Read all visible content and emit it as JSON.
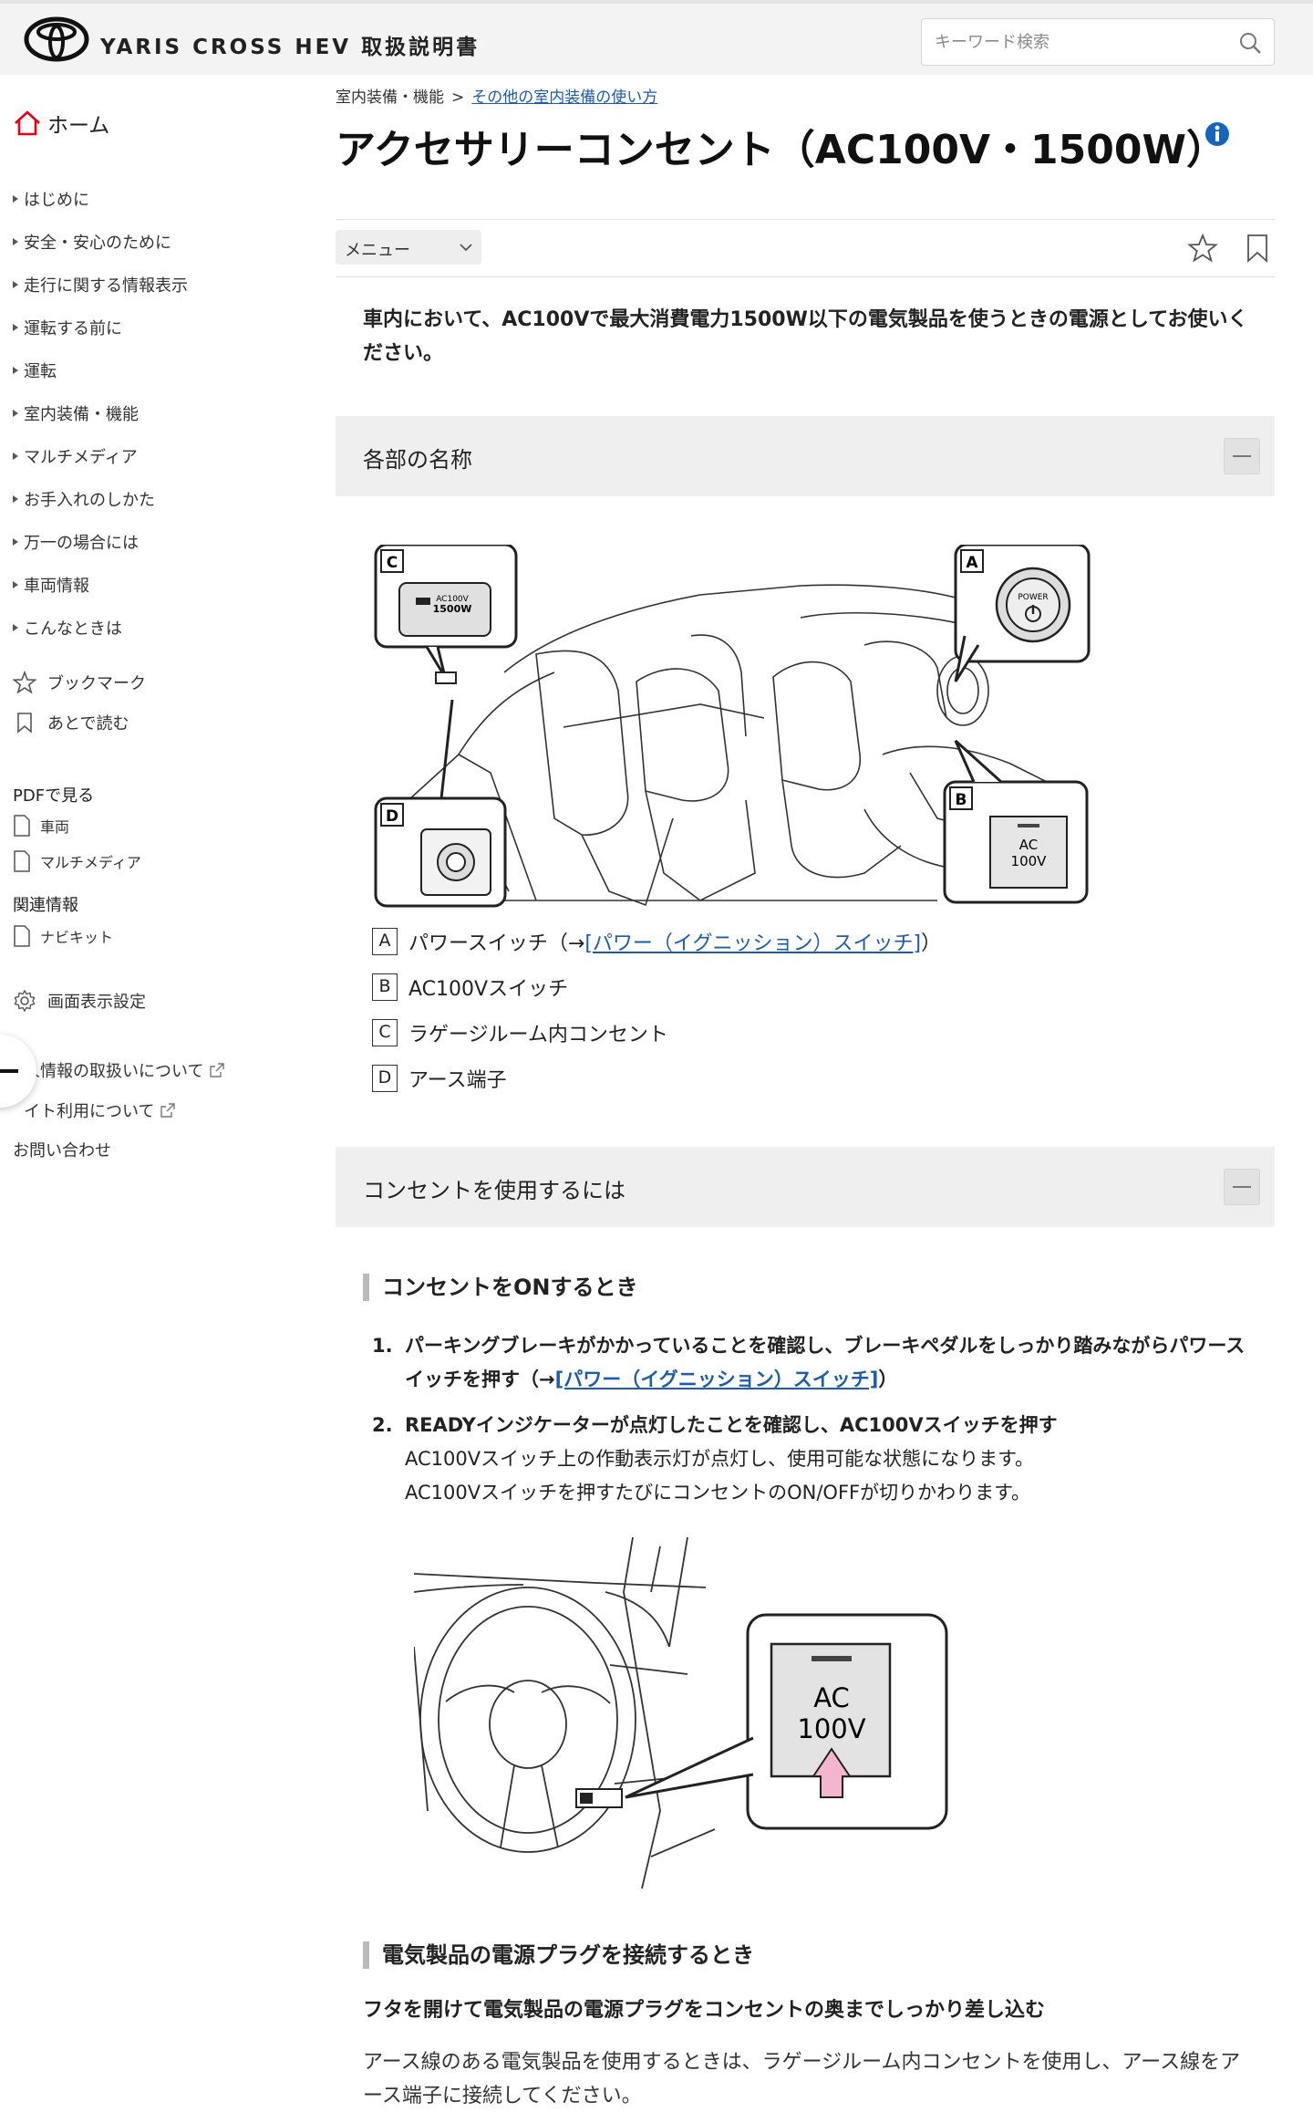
{
  "header": {
    "brand": "YARIS CROSS HEV 取扱説明書",
    "search_placeholder": "キーワード検索"
  },
  "sidebar": {
    "home": "ホーム",
    "nav": [
      "はじめに",
      "安全・安心のために",
      "走行に関する情報表示",
      "運転する前に",
      "運転",
      "室内装備・機能",
      "マルチメディア",
      "お手入れのしかた",
      "万一の場合には",
      "車両情報",
      "こんなときは"
    ],
    "bookmark": "ブックマーク",
    "read_later": "あとで読む",
    "pdf_heading": "PDFで見る",
    "pdf_items": [
      "車両",
      "マルチメディア"
    ],
    "related_heading": "関連情報",
    "related_items": [
      "ナビキット"
    ],
    "display_settings": "画面表示設定",
    "footer_links": [
      "人情報の取扱いについて",
      "イト利用について",
      "お問い合わせ"
    ]
  },
  "breadcrumb": {
    "parent": "室内装備・機能",
    "separator": ">",
    "current": "その他の室内装備の使い方"
  },
  "page": {
    "title": "アクセサリーコンセント（AC100V・1500W）",
    "menu_label": "メニュー",
    "intro": "車内において、AC100Vで最大消費電力1500W以下の電気製品を使うときの電源としてお使いください。"
  },
  "section1": {
    "title": "各部の名称",
    "figure_labels": {
      "a": "A",
      "b": "B",
      "c": "C",
      "d": "D",
      "power_line1": "POWER",
      "ac_line1": "AC",
      "ac_line2": "100V",
      "c_line1": "AC100V",
      "c_line2": "1500W"
    },
    "legend": [
      {
        "key": "A",
        "text": "パワースイッチ（→",
        "link": "[パワー（イグニッション）スイッチ]",
        "tail": "）"
      },
      {
        "key": "B",
        "text": "AC100Vスイッチ"
      },
      {
        "key": "C",
        "text": "ラゲージルーム内コンセント"
      },
      {
        "key": "D",
        "text": "アース端子"
      }
    ]
  },
  "section2": {
    "title": "コンセントを使用するには",
    "subhead_on": "コンセントをONするとき",
    "steps": [
      {
        "num": "1.",
        "text": "パーキングブレーキがかかっていることを確認し、ブレーキペダルをしっかり踏みながらパワースイッチを押す（→",
        "link": "[パワー（イグニッション）スイッチ]",
        "tail": "）"
      },
      {
        "num": "2.",
        "text": "READYインジケーターが点灯したことを確認し、AC100Vスイッチを押す",
        "sub1": "AC100Vスイッチ上の作動表示灯が点灯し、使用可能な状態になります。",
        "sub2": "AC100Vスイッチを押すたびにコンセントのON/OFFが切りかわります。"
      }
    ],
    "figure2": {
      "line1": "AC",
      "line2": "100V"
    },
    "subhead_plug": "電気製品の電源プラグを接続するとき",
    "plug_bold": "フタを開けて電気製品の電源プラグをコンセントの奥までしっかり差し込む",
    "plug_text": "アース線のある電気製品を使用するときは、ラゲージルーム内コンセントを使用し、アース線をアース端子に接続してください。"
  },
  "colors": {
    "accent_red": "#e60012",
    "link_blue": "#1a5db0",
    "info_blue": "#1565c0",
    "arrow_pink": "#f4b6cf"
  }
}
